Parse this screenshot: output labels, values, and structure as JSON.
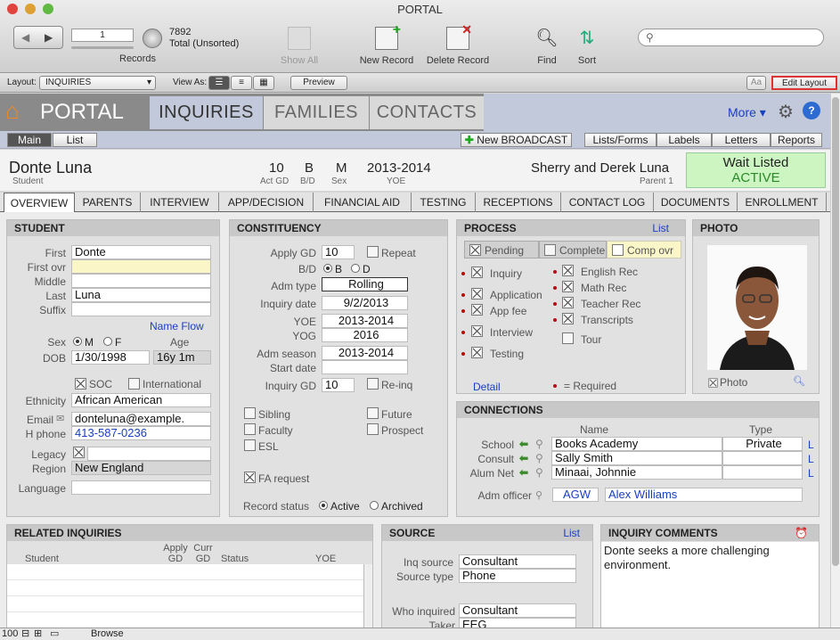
{
  "window": {
    "title": "PORTAL"
  },
  "toolbar": {
    "record_number": "1",
    "record_count": "7892",
    "record_total": "Total (Unsorted)",
    "records_label": "Records",
    "show_all": "Show All",
    "new_record": "New Record",
    "delete_record": "Delete Record",
    "find": "Find",
    "sort": "Sort",
    "search_placeholder": ""
  },
  "layoutbar": {
    "layout_label": "Layout:",
    "layout_value": "INQUIRIES",
    "view_as_label": "View As:",
    "preview": "Preview",
    "aa": "Aa",
    "edit_layout": "Edit Layout"
  },
  "nav": {
    "portal": "PORTAL",
    "tabs": [
      "INQUIRIES",
      "FAMILIES",
      "CONTACTS"
    ],
    "more": "More"
  },
  "subbar": {
    "main": "Main",
    "list": "List",
    "new_broadcast": "New BROADCAST",
    "lists_forms": "Lists/Forms",
    "labels": "Labels",
    "letters": "Letters",
    "reports": "Reports"
  },
  "person": {
    "name": "Donte Luna",
    "role": "Student",
    "act_gd": "10",
    "act_gd_label": "Act GD",
    "bd": "B",
    "bd_label": "B/D",
    "sex": "M",
    "sex_label": "Sex",
    "yoe": "2013-2014",
    "yoe_label": "YOE",
    "parent": "Sherry and Derek Luna",
    "parent_label": "Parent 1",
    "status1": "Wait Listed",
    "status2": "ACTIVE"
  },
  "tabs": [
    "OVERVIEW",
    "PARENTS",
    "INTERVIEW",
    "APP/DECISION",
    "FINANCIAL AID",
    "TESTING",
    "RECEPTIONS",
    "CONTACT LOG",
    "DOCUMENTS",
    "ENROLLMENT"
  ],
  "student": {
    "title": "STUDENT",
    "first_l": "First",
    "first": "Donte",
    "firstovr_l": "First ovr",
    "middle_l": "Middle",
    "last_l": "Last",
    "last": "Luna",
    "suffix_l": "Suffix",
    "name_flow": "Name Flow",
    "sex_l": "Sex",
    "m": "M",
    "f": "F",
    "age_l": "Age",
    "dob_l": "DOB",
    "dob": "1/30/1998",
    "age": "16y 1m",
    "soc": "SOC",
    "international": "International",
    "ethnicity_l": "Ethnicity",
    "ethnicity": "African American",
    "email_l": "Email",
    "email": "donteluna@example.",
    "hphone_l": "H phone",
    "hphone": "413-587-0236",
    "legacy_l": "Legacy",
    "region_l": "Region",
    "region": "New England",
    "language_l": "Language"
  },
  "constituency": {
    "title": "CONSTITUENCY",
    "applygd_l": "Apply GD",
    "applygd": "10",
    "repeat": "Repeat",
    "bd_l": "B/D",
    "b": "B",
    "d": "D",
    "admtype_l": "Adm type",
    "admtype": "Rolling",
    "inqdate_l": "Inquiry date",
    "inqdate": "9/2/2013",
    "yoe_l": "YOE",
    "yoe": "2013-2014",
    "yog_l": "YOG",
    "yog": "2016",
    "admseason_l": "Adm season",
    "admseason": "2013-2014",
    "startdate_l": "Start date",
    "inqgd_l": "Inquiry GD",
    "inqgd": "10",
    "reinq": "Re-inq",
    "sibling": "Sibling",
    "future": "Future",
    "faculty": "Faculty",
    "prospect": "Prospect",
    "esl": "ESL",
    "fa_request": "FA request",
    "record_status_l": "Record status",
    "active": "Active",
    "archived": "Archived"
  },
  "process": {
    "title": "PROCESS",
    "list": "List",
    "pending": "Pending",
    "complete": "Complete",
    "comp_ovr": "Comp ovr",
    "left": [
      "Inquiry",
      "Application",
      "App fee",
      "Interview",
      "Testing"
    ],
    "right": [
      "English Rec",
      "Math Rec",
      "Teacher Rec",
      "Transcripts",
      "Tour"
    ],
    "detail": "Detail",
    "required": "= Required"
  },
  "photo": {
    "title": "PHOTO",
    "label": "Photo"
  },
  "connections": {
    "title": "CONNECTIONS",
    "name_h": "Name",
    "type_h": "Type",
    "rows": [
      {
        "label": "School",
        "name": "Books Academy",
        "type": "Private",
        "l": "L"
      },
      {
        "label": "Consult",
        "name": "Sally Smith",
        "type": "",
        "l": "L"
      },
      {
        "label": "Alum Net",
        "name": "Minaai, Johnnie",
        "type": "",
        "l": "L"
      }
    ],
    "adm_officer_l": "Adm officer",
    "adm_code": "AGW",
    "adm_name": "Alex Williams"
  },
  "related": {
    "title": "RELATED INQUIRIES",
    "cols": [
      "Student",
      "Apply GD",
      "Curr GD",
      "Status",
      "YOE"
    ]
  },
  "source": {
    "title": "SOURCE",
    "list": "List",
    "inq_source_l": "Inq source",
    "inq_source": "Consultant",
    "source_type_l": "Source type",
    "source_type": "Phone",
    "who_l": "Who inquired",
    "who": "Consultant",
    "taker_l": "Taker",
    "taker": "EEG"
  },
  "comments": {
    "title": "INQUIRY COMMENTS",
    "text": "Donte seeks a more challenging environment."
  },
  "statusbar": {
    "zoom": "100",
    "mode": "Browse"
  }
}
